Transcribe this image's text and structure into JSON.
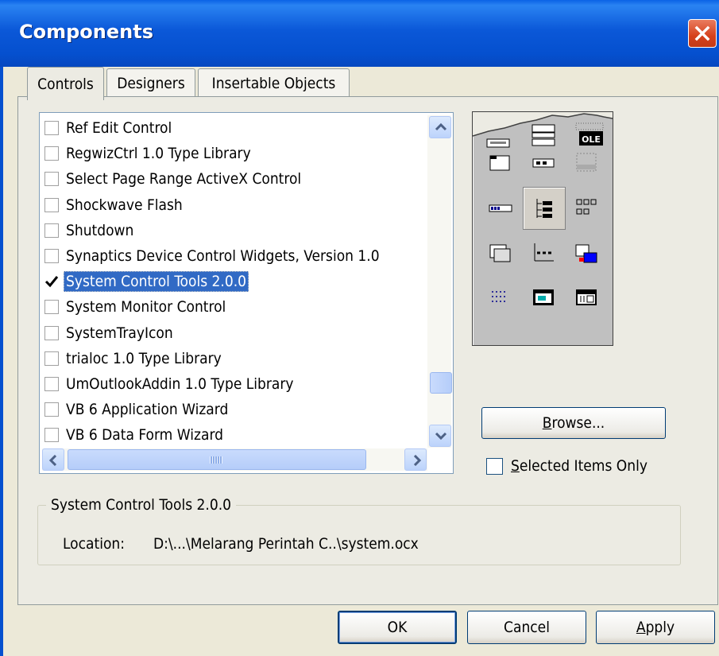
{
  "window": {
    "title": "Components"
  },
  "tabs": [
    {
      "label": "Controls",
      "active": true
    },
    {
      "label": "Designers",
      "active": false
    },
    {
      "label": "Insertable Objects",
      "active": false
    }
  ],
  "controls_list": [
    {
      "label": "Ref Edit Control",
      "checked": false,
      "selected": false
    },
    {
      "label": "RegwizCtrl 1.0 Type Library",
      "checked": false,
      "selected": false
    },
    {
      "label": "Select Page Range ActiveX Control",
      "checked": false,
      "selected": false
    },
    {
      "label": "Shockwave Flash",
      "checked": false,
      "selected": false
    },
    {
      "label": "Shutdown",
      "checked": false,
      "selected": false
    },
    {
      "label": "Synaptics Device Control Widgets, Version 1.0",
      "checked": false,
      "selected": false
    },
    {
      "label": "System Control Tools 2.0.0",
      "checked": true,
      "selected": true
    },
    {
      "label": "System Monitor Control",
      "checked": false,
      "selected": false
    },
    {
      "label": "SystemTrayIcon",
      "checked": false,
      "selected": false
    },
    {
      "label": "trialoc 1.0 Type Library",
      "checked": false,
      "selected": false
    },
    {
      "label": "UmOutlookAddin 1.0 Type Library",
      "checked": false,
      "selected": false
    },
    {
      "label": "VB 6 Application Wizard",
      "checked": false,
      "selected": false
    },
    {
      "label": "VB 6 Data Form Wizard",
      "checked": false,
      "selected": false
    }
  ],
  "toolbox_preview": {
    "top_label": "OLE",
    "icons": [
      "tab-strip-icon",
      "toolbar-icon",
      "status-bar-icon",
      "progress-bar-icon",
      "tree-view-icon",
      "list-view-icon",
      "image-list-icon",
      "slider-icon",
      "image-combo-icon",
      "dotted-grid-icon",
      "animation-icon",
      "date-picker-icon"
    ]
  },
  "buttons": {
    "browse": {
      "label": "Browse...",
      "accel": "B",
      "rest": "rowse..."
    },
    "ok": "OK",
    "cancel": "Cancel",
    "apply": {
      "accel": "A",
      "rest": "pply"
    }
  },
  "selected_items_only": {
    "accel": "S",
    "rest": "elected Items Only",
    "checked": false
  },
  "details": {
    "group_title": "System Control Tools 2.0.0",
    "location_label": "Location:",
    "location_value": "D:\\...\\Melarang Perintah C..\\system.ocx"
  },
  "colors": {
    "title_bar": "#0550cf",
    "selection": "#316ac5",
    "close_button": "#d6411c",
    "dialog_face": "#ecebe3"
  }
}
